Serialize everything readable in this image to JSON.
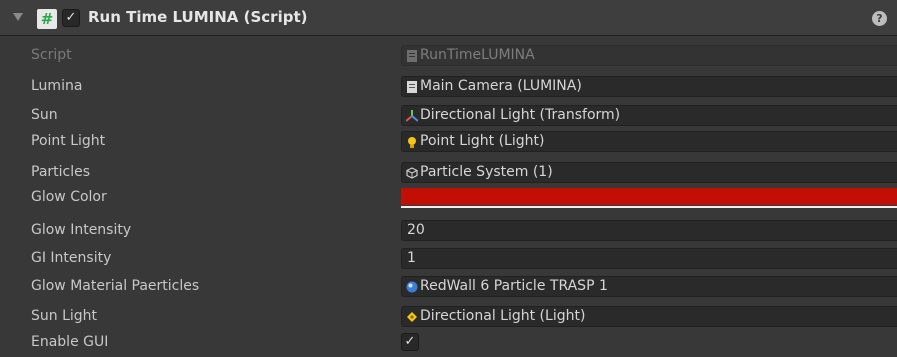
{
  "component": {
    "title": "Run Time LUMINA (Script)",
    "enabled": true,
    "help_icon": "help-icon",
    "script_icon": "#"
  },
  "fields": {
    "script": {
      "label": "Script",
      "value": "RunTimeLUMINA",
      "icon": "script-asset-icon"
    },
    "lumina": {
      "label": "Lumina",
      "value": "Main Camera (LUMINA)",
      "icon": "script-asset-icon"
    },
    "sun": {
      "label": "Sun",
      "value": "Directional Light (Transform)",
      "icon": "transform-icon"
    },
    "point_light": {
      "label": "Point Light",
      "value": "Point Light (Light)",
      "icon": "lightbulb-icon"
    },
    "particles": {
      "label": "Particles",
      "value": "Particle System (1)",
      "icon": "particle-system-icon"
    },
    "glow_color": {
      "label": "Glow Color",
      "color": "#c20f06"
    },
    "glow_intensity": {
      "label": "Glow Intensity",
      "value": "20"
    },
    "gi_intensity": {
      "label": "GI Intensity",
      "value": "1"
    },
    "glow_material": {
      "label": "Glow Material Paerticles",
      "value": "RedWall 6 Particle TRASP 1",
      "icon": "material-sphere-icon"
    },
    "sun_light": {
      "label": "Sun Light",
      "value": "Directional Light (Light)",
      "icon": "directional-light-icon"
    },
    "enable_gui": {
      "label": "Enable GUI",
      "checked": true
    }
  },
  "glyphs": {
    "check": "✓"
  }
}
